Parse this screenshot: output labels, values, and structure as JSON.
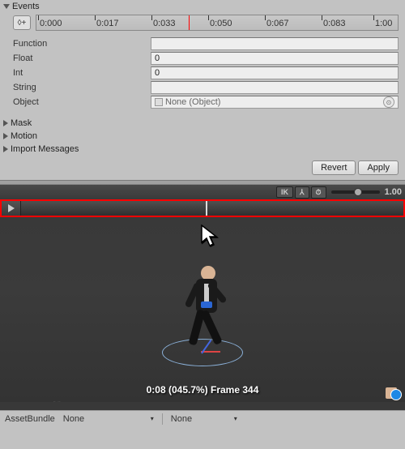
{
  "events": {
    "title": "Events",
    "timeline_ticks": [
      "0:000",
      "0:017",
      "0:033",
      "0:050",
      "0:067",
      "0:083",
      "1:00"
    ]
  },
  "props": {
    "function": {
      "label": "Function",
      "value": ""
    },
    "float": {
      "label": "Float",
      "value": "0"
    },
    "int": {
      "label": "Int",
      "value": "0"
    },
    "string": {
      "label": "String",
      "value": ""
    },
    "object": {
      "label": "Object",
      "value": "None (Object)"
    }
  },
  "sections": {
    "mask": "Mask",
    "motion": "Motion",
    "import_messages": "Import Messages"
  },
  "buttons": {
    "revert": "Revert",
    "apply": "Apply"
  },
  "preview": {
    "ik": "IK",
    "speed": "1.00",
    "frame_readout": "0:08 (045.7%) Frame 344"
  },
  "assetbundle": {
    "label": "AssetBundle",
    "value1": "None",
    "value2": "None"
  }
}
